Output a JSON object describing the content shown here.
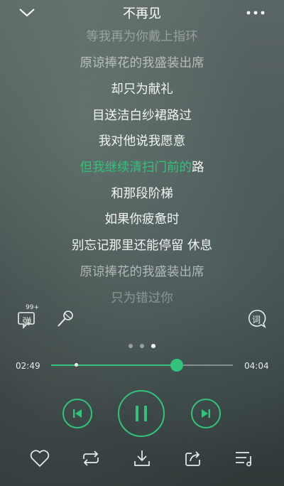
{
  "header": {
    "title": "不再见"
  },
  "lyrics": [
    "等我再为你戴上指环",
    "原谅捧花的我盛装出席",
    "却只为献礼",
    "目送洁白纱裙路过",
    "我对他说我愿意",
    "但我继续清扫门前的路",
    "和那段阶梯",
    "如果你疲惫时",
    "别忘记那里还能停留 休息",
    "原谅捧花的我盛装出席",
    "只为错过你"
  ],
  "current_line": {
    "highlighted": "但我继续清扫门前的",
    "rest": "路"
  },
  "toolbar": {
    "danmu_count": "99+",
    "danmu_label": "弹",
    "lyric_label": "词"
  },
  "pager": {
    "pages": 3,
    "active": 3
  },
  "progress": {
    "elapsed": "02:49",
    "total": "04:04",
    "fraction": 0.692,
    "buffered_fraction": 0.14
  },
  "colors": {
    "accent": "#31c27c"
  },
  "controls": [
    "prev-icon",
    "pause-icon",
    "next-icon"
  ],
  "bottom_bar": [
    "heart-icon",
    "repeat-icon",
    "download-icon",
    "share-icon",
    "playlist-icon"
  ]
}
